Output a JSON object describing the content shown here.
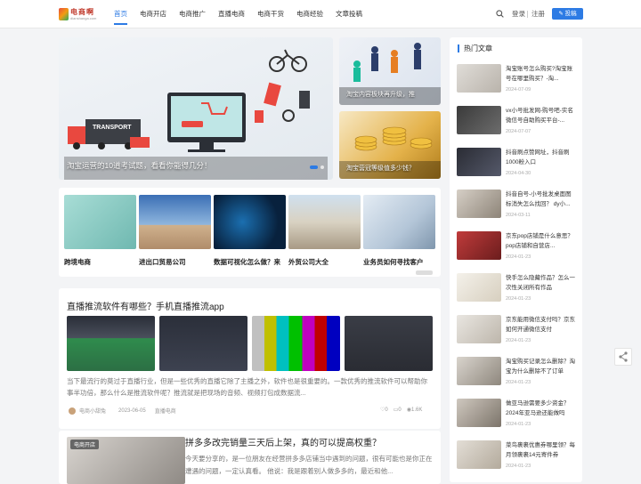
{
  "header": {
    "logo_text": "电商啊",
    "logo_sub": "dianshanga.com",
    "nav": [
      "首页",
      "电商开店",
      "电商推广",
      "直播电商",
      "电商干货",
      "电商经验",
      "文章投稿"
    ],
    "login": "登录",
    "register": "注册",
    "post_button": "投稿"
  },
  "hero": {
    "main_caption": "淘宝运营的10道考试题，看看你能得几分！",
    "side1_caption": "淘宝内容板块再升级，推",
    "side2_caption": "淘宝营冠等级值多少钱？"
  },
  "categories": [
    {
      "label": "跨境电商"
    },
    {
      "label": "进出口贸易公司"
    },
    {
      "label": "数据可视化怎么做？来"
    },
    {
      "label": "外贸公司大全"
    },
    {
      "label": "业务员如何寻找客户"
    }
  ],
  "article1": {
    "title": "直播推流软件有哪些？手机直播推流app",
    "excerpt": "当下最流行的莫过于直播行业，但是一些优秀的直播它除了主播之外，软件也是很重要的。一款优秀的推流软件可以帮助你事半功倍，那么什么是推流软件呢？推流就是把现场的音频、视频打包成数据流...",
    "author": "电商小甜兔",
    "date": "2023-06-05",
    "category": "直播电商",
    "likes": "0",
    "comments": "0",
    "views": "1.6K"
  },
  "article2": {
    "tag": "电商开店",
    "title": "拼多多改完销量三天后上架，真的可以提高权重？",
    "excerpt": "今天要分享的，是一位朋友在经营拼多多店铺当中遇到的问题，很有可能也是你正在遭遇的问题，一定认真看。 他说：我是跟着别人做多多的，最近和他..."
  },
  "hot": {
    "title": "热门文章",
    "items": [
      {
        "title": "淘宝账号怎么购买?淘宝账号在哪里购买？-淘...",
        "date": "2024-07-09"
      },
      {
        "title": "vx小号批发网-购号吧-实名微信号自助购买平台-...",
        "date": "2024-07-07"
      },
      {
        "title": "抖音刷点赞网址，抖音刷1000粉入口",
        "date": "2024-04-30"
      },
      {
        "title": "抖音自号-小号批发桌面图标消失怎么找回？ dy小...",
        "date": "2024-03-11"
      },
      {
        "title": "京东pop店铺是什么意思？pop店铺和自营店...",
        "date": "2024-01-23"
      },
      {
        "title": "快手怎么隐藏作品？怎么一次性关闭所有作品",
        "date": "2024-01-23"
      },
      {
        "title": "京东能用微信支付吗？京东如何开通微信支付",
        "date": "2024-01-23"
      },
      {
        "title": "淘宝购买记录怎么删除？淘宝为什么删除不了订单",
        "date": "2024-01-23"
      },
      {
        "title": "做亚马逊需要多少资金？2024年亚马逊还能做吗",
        "date": "2024-01-23"
      },
      {
        "title": "菜鸟裹裹优惠券哪里领？每月领裹裹14元寄件券",
        "date": "2024-01-23"
      }
    ]
  },
  "colors": {
    "accent": "#2d7be4",
    "bg": "#f3f4f6"
  }
}
